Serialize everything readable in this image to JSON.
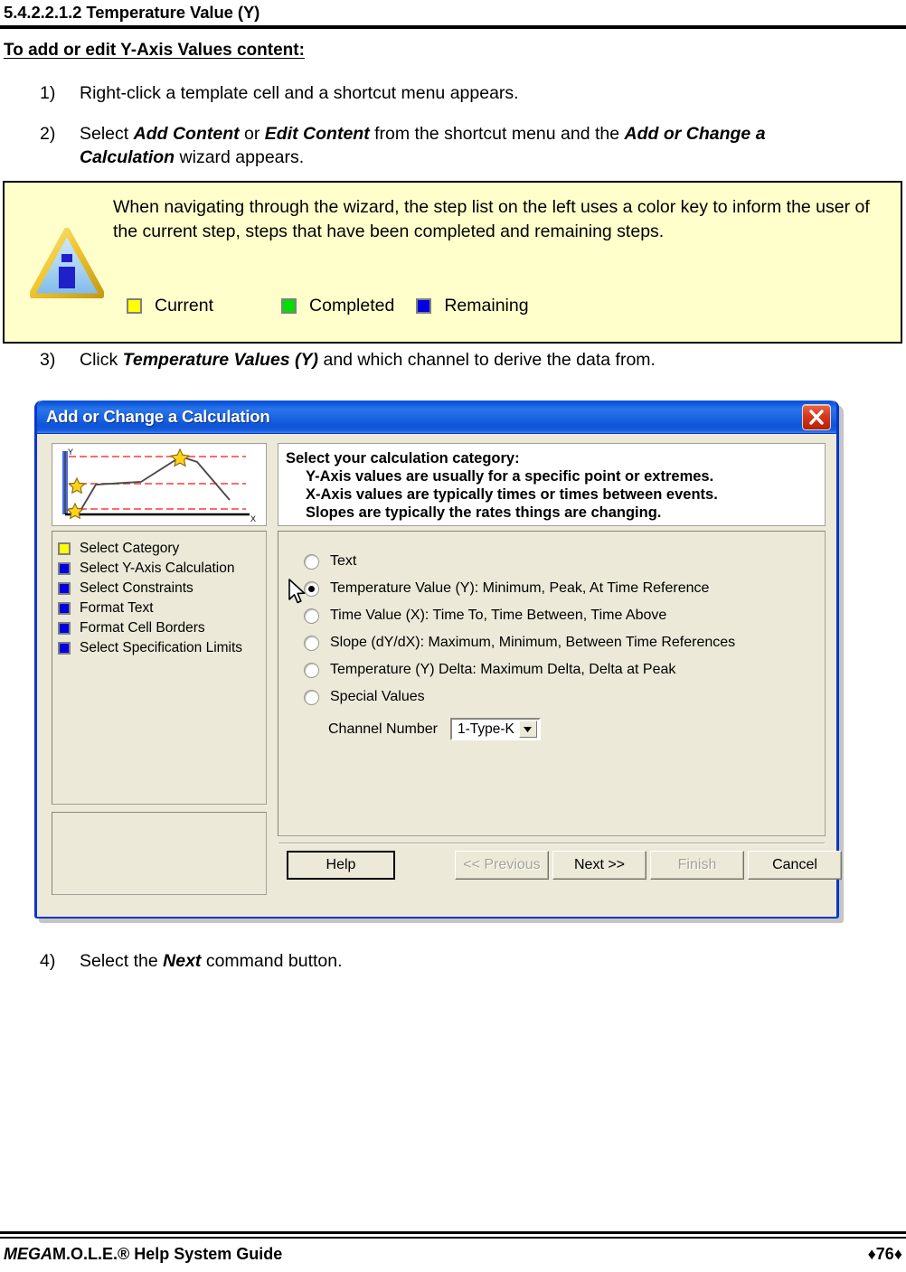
{
  "document": {
    "heading": "5.4.2.2.1.2 Temperature Value (Y)",
    "sub_heading": "To add or edit Y-Axis Values content:",
    "steps": {
      "s1_num": "1)",
      "s1_text": "Right-click a template cell and a shortcut menu appears.",
      "s2_num": "2)",
      "s2_a": "Select ",
      "s2_b1": "Add Content",
      "s2_c": " or ",
      "s2_b2": "Edit Content",
      "s2_d": " from the shortcut menu and the ",
      "s2_b3": "Add or Change a Calculation",
      "s2_e": " wizard appears.",
      "s3_num": "3)",
      "s3_a": "Click ",
      "s3_b": "Temperature Values (Y)",
      "s3_c": " and which channel to derive the data from.",
      "s4_num": "4)",
      "s4_a": "Select the ",
      "s4_b": "Next",
      "s4_c": " command button."
    }
  },
  "note": {
    "icon": "info-triangle-icon",
    "text": "When navigating through the wizard, the step list on the left uses a color key to inform the user of the current step, steps that have been completed and remaining steps.",
    "legend": [
      {
        "label": "Current",
        "color": "#ffff00"
      },
      {
        "label": "Completed",
        "color": "#00e000"
      },
      {
        "label": "Remaining",
        "color": "#0000e0"
      }
    ],
    "background": "#ffffcc"
  },
  "dialog": {
    "title": "Add or Change a Calculation",
    "close_icon": "close-icon",
    "titlebar_color": "#1d66e4",
    "face_color": "#ece9d8",
    "preview": {
      "y_label": "Y",
      "x_label": "X",
      "star_count": 3,
      "limit_line_color": "#ff6a6a"
    },
    "steps": [
      {
        "label": "Select Category",
        "color": "#ffff00",
        "state": "current"
      },
      {
        "label": "Select Y-Axis Calculation",
        "color": "#0000e0",
        "state": "remaining"
      },
      {
        "label": "Select Constraints",
        "color": "#0000e0",
        "state": "remaining"
      },
      {
        "label": "Format Text",
        "color": "#0000e0",
        "state": "remaining"
      },
      {
        "label": "Format Cell Borders",
        "color": "#0000e0",
        "state": "remaining"
      },
      {
        "label": "Select Specification Limits",
        "color": "#0000e0",
        "state": "remaining"
      }
    ],
    "info": {
      "line1": "Select your calculation category:",
      "line2": "Y-Axis values are usually for a specific point or extremes.",
      "line3": "X-Axis values are typically times or times between events.",
      "line4": "Slopes are typically the rates things are changing."
    },
    "options": [
      {
        "label": "Text",
        "selected": false
      },
      {
        "label": "Temperature Value (Y):  Minimum, Peak, At Time Reference",
        "selected": true
      },
      {
        "label": "Time Value (X):  Time To, Time Between, Time Above",
        "selected": false
      },
      {
        "label": "Slope (dY/dX):  Maximum, Minimum, Between Time References",
        "selected": false
      },
      {
        "label": "Temperature (Y) Delta:  Maximum Delta, Delta at Peak",
        "selected": false
      },
      {
        "label": "Special  Values",
        "selected": false
      }
    ],
    "channel": {
      "label": "Channel Number",
      "value": "1-Type-K",
      "dropdown_icon": "chevron-down-icon"
    },
    "buttons": {
      "help": "Help",
      "previous": "<< Previous",
      "next": "Next >>",
      "finish": "Finish",
      "cancel": "Cancel"
    }
  },
  "footer": {
    "brand_italic": "MEGA",
    "brand_rest": "M.O.L.E.® Help System Guide",
    "page": "♦76♦"
  }
}
